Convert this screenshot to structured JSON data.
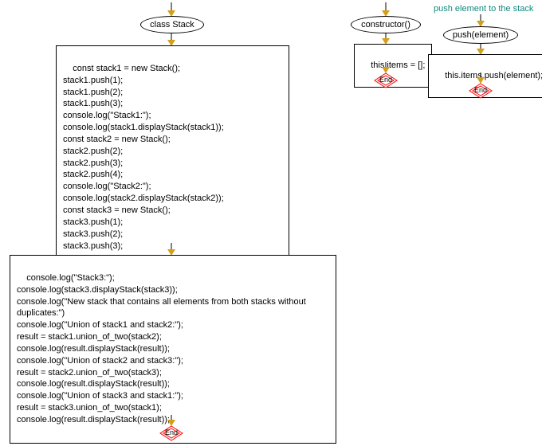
{
  "flow1": {
    "class_label": "class Stack",
    "block1_lines": [
      "const stack1 = new Stack();",
      "stack1.push(1);",
      "stack1.push(2);",
      "stack1.push(3);",
      "console.log(\"Stack1:\");",
      "console.log(stack1.displayStack(stack1));",
      "const stack2 = new Stack();",
      "stack2.push(2);",
      "stack2.push(3);",
      "stack2.push(4);",
      "console.log(\"Stack2:\");",
      "console.log(stack2.displayStack(stack2));",
      "const stack3 = new Stack();",
      "stack3.push(1);",
      "stack3.push(2);",
      "stack3.push(3);"
    ],
    "block2_lines": [
      "console.log(\"Stack3:\");",
      "console.log(stack3.displayStack(stack3));",
      "console.log(\"New stack that contains all elements from both stacks without",
      "duplicates:\")",
      "console.log(\"Union of stack1 and stack2:\");",
      "result = stack1.union_of_two(stack2);",
      "console.log(result.displayStack(result));",
      "console.log(\"Union of stack2 and stack3:\");",
      "result = stack2.union_of_two(stack3);",
      "console.log(result.displayStack(result));",
      "console.log(\"Union of stack3 and stack1:\");",
      "result = stack3.union_of_two(stack1);",
      "console.log(result.displayStack(result));"
    ],
    "end_label": "End"
  },
  "flow2": {
    "constructor_label": "constructor()",
    "assign_label": "this.items = [];",
    "end_label": "End"
  },
  "flow3": {
    "comment": "push element to the stack",
    "push_label": "push(element)",
    "body_label": "this.items.push(element);",
    "end_label": "End"
  }
}
